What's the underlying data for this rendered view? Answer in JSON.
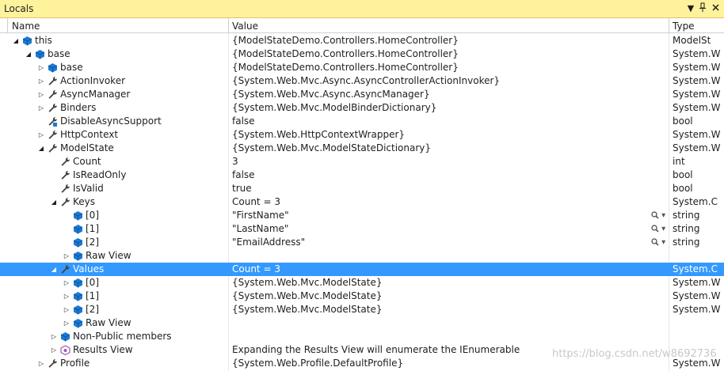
{
  "window": {
    "title": "Locals",
    "buttons": [
      "dropdown",
      "pin",
      "close"
    ]
  },
  "columns": {
    "name": "Name",
    "value": "Value",
    "type": "Type"
  },
  "rows": [
    {
      "name": "this",
      "value": "{ModelStateDemo.Controllers.HomeController}",
      "type": "ModelSt",
      "depth": 0,
      "expander": "expanded",
      "icon": "object-icon"
    },
    {
      "name": "base",
      "value": "{ModelStateDemo.Controllers.HomeController}",
      "type": "System.W",
      "depth": 1,
      "expander": "expanded",
      "icon": "object-icon"
    },
    {
      "name": "base",
      "value": "{ModelStateDemo.Controllers.HomeController}",
      "type": "System.W",
      "depth": 2,
      "expander": "collapsed",
      "icon": "object-icon"
    },
    {
      "name": "ActionInvoker",
      "value": "{System.Web.Mvc.Async.AsyncControllerActionInvoker}",
      "type": "System.W",
      "depth": 2,
      "expander": "collapsed",
      "icon": "wrench-icon"
    },
    {
      "name": "AsyncManager",
      "value": "{System.Web.Mvc.Async.AsyncManager}",
      "type": "System.W",
      "depth": 2,
      "expander": "collapsed",
      "icon": "wrench-icon"
    },
    {
      "name": "Binders",
      "value": "{System.Web.Mvc.ModelBinderDictionary}",
      "type": "System.W",
      "depth": 2,
      "expander": "collapsed",
      "icon": "wrench-icon"
    },
    {
      "name": "DisableAsyncSupport",
      "value": "false",
      "type": "bool",
      "depth": 2,
      "expander": "none",
      "icon": "wrench-readonly-icon"
    },
    {
      "name": "HttpContext",
      "value": "{System.Web.HttpContextWrapper}",
      "type": "System.W",
      "depth": 2,
      "expander": "collapsed",
      "icon": "wrench-icon"
    },
    {
      "name": "ModelState",
      "value": "{System.Web.Mvc.ModelStateDictionary}",
      "type": "System.W",
      "depth": 2,
      "expander": "expanded",
      "icon": "wrench-icon"
    },
    {
      "name": "Count",
      "value": "3",
      "type": "int",
      "depth": 3,
      "expander": "none",
      "icon": "wrench-icon"
    },
    {
      "name": "IsReadOnly",
      "value": "false",
      "type": "bool",
      "depth": 3,
      "expander": "none",
      "icon": "wrench-icon"
    },
    {
      "name": "IsValid",
      "value": "true",
      "type": "bool",
      "depth": 3,
      "expander": "none",
      "icon": "wrench-icon"
    },
    {
      "name": "Keys",
      "value": "Count = 3",
      "type": "System.C",
      "depth": 3,
      "expander": "expanded",
      "icon": "wrench-icon"
    },
    {
      "name": "[0]",
      "value": "\"FirstName\"",
      "type": "string",
      "depth": 4,
      "expander": "none",
      "icon": "object-icon",
      "magnifier": true
    },
    {
      "name": "[1]",
      "value": "\"LastName\"",
      "type": "string",
      "depth": 4,
      "expander": "none",
      "icon": "object-icon",
      "magnifier": true
    },
    {
      "name": "[2]",
      "value": "\"EmailAddress\"",
      "type": "string",
      "depth": 4,
      "expander": "none",
      "icon": "object-icon",
      "magnifier": true
    },
    {
      "name": "Raw View",
      "value": "",
      "type": "",
      "depth": 4,
      "expander": "collapsed",
      "icon": "object-icon"
    },
    {
      "name": "Values",
      "value": "Count = 3",
      "type": "System.C",
      "depth": 3,
      "expander": "expanded",
      "icon": "wrench-icon",
      "selected": true
    },
    {
      "name": "[0]",
      "value": "{System.Web.Mvc.ModelState}",
      "type": "System.W",
      "depth": 4,
      "expander": "collapsed",
      "icon": "object-icon"
    },
    {
      "name": "[1]",
      "value": "{System.Web.Mvc.ModelState}",
      "type": "System.W",
      "depth": 4,
      "expander": "collapsed",
      "icon": "object-icon"
    },
    {
      "name": "[2]",
      "value": "{System.Web.Mvc.ModelState}",
      "type": "System.W",
      "depth": 4,
      "expander": "collapsed",
      "icon": "object-icon"
    },
    {
      "name": "Raw View",
      "value": "",
      "type": "",
      "depth": 4,
      "expander": "collapsed",
      "icon": "object-icon"
    },
    {
      "name": "Non-Public members",
      "value": "",
      "type": "",
      "depth": 3,
      "expander": "collapsed",
      "icon": "object-icon"
    },
    {
      "name": "Results View",
      "value": "Expanding the Results View will enumerate the IEnumerable",
      "type": "",
      "depth": 3,
      "expander": "collapsed",
      "icon": "results-view-icon"
    },
    {
      "name": "Profile",
      "value": "{System.Web.Profile.DefaultProfile}",
      "type": "System.W",
      "depth": 2,
      "expander": "collapsed",
      "icon": "wrench-icon"
    }
  ],
  "watermark": "https://blog.csdn.net/w8692736"
}
